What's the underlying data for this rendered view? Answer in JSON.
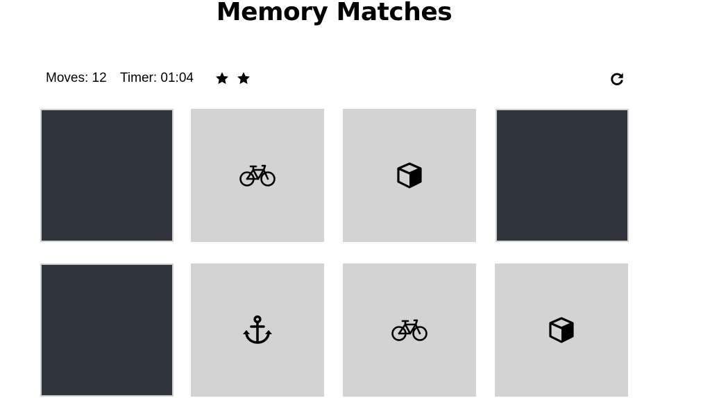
{
  "header": {
    "title": "Memory Matches"
  },
  "score_panel": {
    "moves_label": "Moves:",
    "moves_value": "12",
    "timer_label": "Timer:",
    "timer_value": "01:04",
    "stars": [
      {
        "icon": "star-icon",
        "filled": true
      },
      {
        "icon": "star-icon",
        "filled": true
      }
    ],
    "restart_icon": "redo-icon"
  },
  "colors": {
    "closed_card": "#2e353d",
    "open_card": "#d3d3d3",
    "closed_card_border": "#cfcfcf"
  },
  "deck": [
    {
      "state": "closed",
      "icon": ""
    },
    {
      "state": "open",
      "icon": "bicycle-icon"
    },
    {
      "state": "open",
      "icon": "cube-icon"
    },
    {
      "state": "closed",
      "icon": ""
    },
    {
      "state": "closed",
      "icon": ""
    },
    {
      "state": "open",
      "icon": "anchor-icon"
    },
    {
      "state": "open",
      "icon": "bicycle-icon"
    },
    {
      "state": "open",
      "icon": "cube-icon"
    }
  ]
}
